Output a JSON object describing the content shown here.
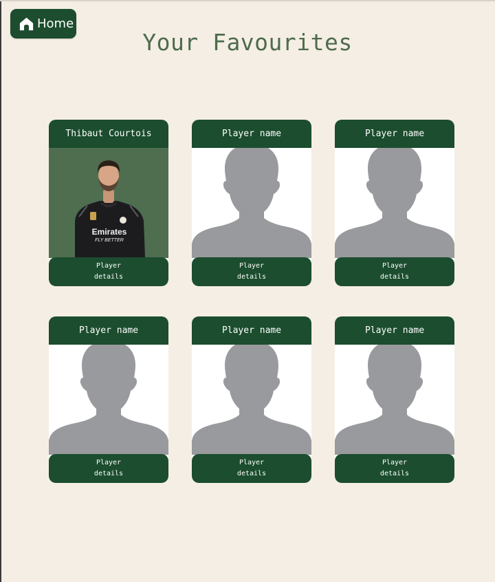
{
  "nav": {
    "home_label": "Home",
    "home_icon": "home-icon"
  },
  "page": {
    "title": "Your Favourites",
    "background": "#f5eee4",
    "accent": "#1b4d2e",
    "title_color": "#4d6b4c"
  },
  "cards": [
    {
      "name": "Thibaut Courtois",
      "photo": "player-photo",
      "details_line1": "Player",
      "details_line2": "details",
      "shirt_sponsor_line1": "Emirates",
      "shirt_sponsor_line2": "FLY BETTER"
    },
    {
      "name": "Player name",
      "photo": "placeholder-silhouette",
      "details_line1": "Player",
      "details_line2": "details"
    },
    {
      "name": "Player name",
      "photo": "placeholder-silhouette",
      "details_line1": "Player",
      "details_line2": "details"
    },
    {
      "name": "Player name",
      "photo": "placeholder-silhouette",
      "details_line1": "Player",
      "details_line2": "details"
    },
    {
      "name": "Player name",
      "photo": "placeholder-silhouette",
      "details_line1": "Player",
      "details_line2": "details"
    },
    {
      "name": "Player name",
      "photo": "placeholder-silhouette",
      "details_line1": "Player",
      "details_line2": "details"
    }
  ]
}
